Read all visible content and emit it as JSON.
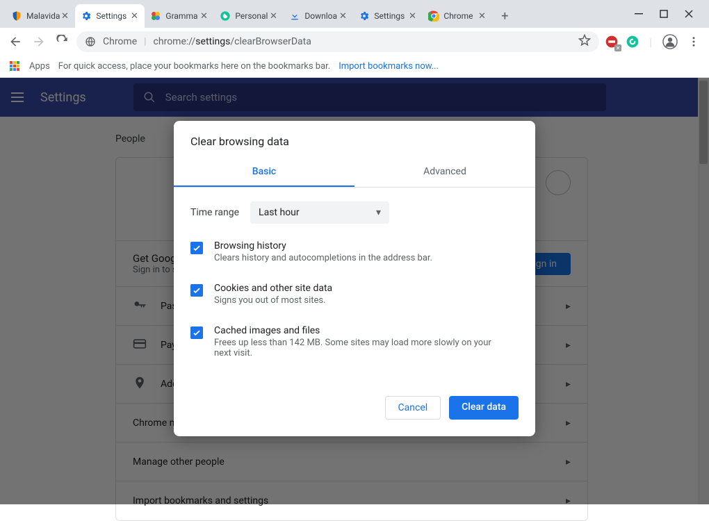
{
  "window": {
    "tabs": [
      {
        "label": "Malavida",
        "active": false
      },
      {
        "label": "Settings",
        "active": true
      },
      {
        "label": "Gramma",
        "active": false
      },
      {
        "label": "Personal",
        "active": false
      },
      {
        "label": "Downloa",
        "active": false
      },
      {
        "label": "Settings",
        "active": false
      },
      {
        "label": "Chrome",
        "active": false
      }
    ]
  },
  "omnibox": {
    "scheme_label": "Chrome",
    "url_prefix": "chrome://",
    "url_bold": "settings",
    "url_rest": "/clearBrowserData"
  },
  "bookmarks_bar": {
    "apps_label": "Apps",
    "hint": "For quick access, place your bookmarks here on the bookmarks bar.",
    "import_link": "Import bookmarks now..."
  },
  "settings_header": {
    "title": "Settings",
    "search_placeholder": "Search settings"
  },
  "page": {
    "section": "People",
    "sync_title": "Get Google smarts in Chrome",
    "sync_sub": "Sign in to sync and personalize Chrome across your devices",
    "signin": "Sign in",
    "rows": [
      {
        "icon": "key",
        "label": "Passwords"
      },
      {
        "icon": "card",
        "label": "Payment methods"
      },
      {
        "icon": "pin",
        "label": "Addresses and more"
      }
    ],
    "row_chrome_name": "Chrome name and picture",
    "row_manage": "Manage other people",
    "row_import": "Import bookmarks and settings"
  },
  "dialog": {
    "title": "Clear browsing data",
    "tab_basic": "Basic",
    "tab_advanced": "Advanced",
    "time_range_label": "Time range",
    "time_range_value": "Last hour",
    "options": [
      {
        "title": "Browsing history",
        "desc": "Clears history and autocompletions in the address bar.",
        "checked": true
      },
      {
        "title": "Cookies and other site data",
        "desc": "Signs you out of most sites.",
        "checked": true
      },
      {
        "title": "Cached images and files",
        "desc": "Frees up less than 142 MB. Some sites may load more slowly on your next visit.",
        "checked": true
      }
    ],
    "cancel": "Cancel",
    "confirm": "Clear data"
  }
}
